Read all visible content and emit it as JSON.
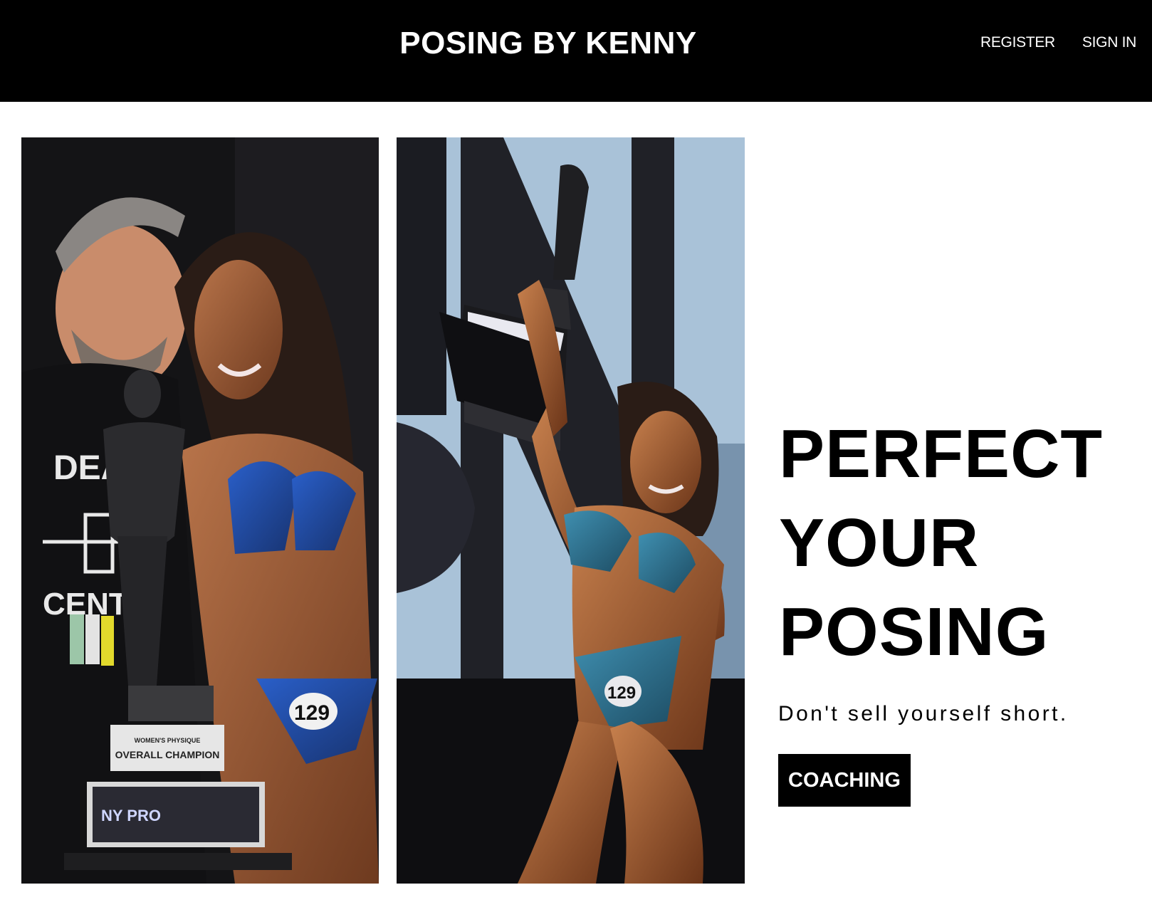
{
  "header": {
    "brand": "POSING BY KENNY",
    "nav": {
      "register": "REGISTER",
      "sign_in": "SIGN IN"
    }
  },
  "hero": {
    "headline_lines": [
      "PERFECT",
      "YOUR",
      "POSING"
    ],
    "tagline": "Don't sell yourself short.",
    "cta_label": "COACHING"
  },
  "photos": {
    "left": {
      "shirt_text_top": "DEA",
      "shirt_text_bottom": "CENT",
      "trophy_plaque_line1": "WOMEN'S PHYSIQUE",
      "trophy_plaque_line2": "OVERALL CHAMPION",
      "trophy_base_logo": "NY PRO",
      "competitor_number": "129"
    },
    "right": {
      "competitor_number": "129"
    }
  },
  "colors": {
    "header_bg": "#000000",
    "page_bg": "#ffffff",
    "cta_bg": "#000000",
    "cta_text": "#ffffff"
  }
}
